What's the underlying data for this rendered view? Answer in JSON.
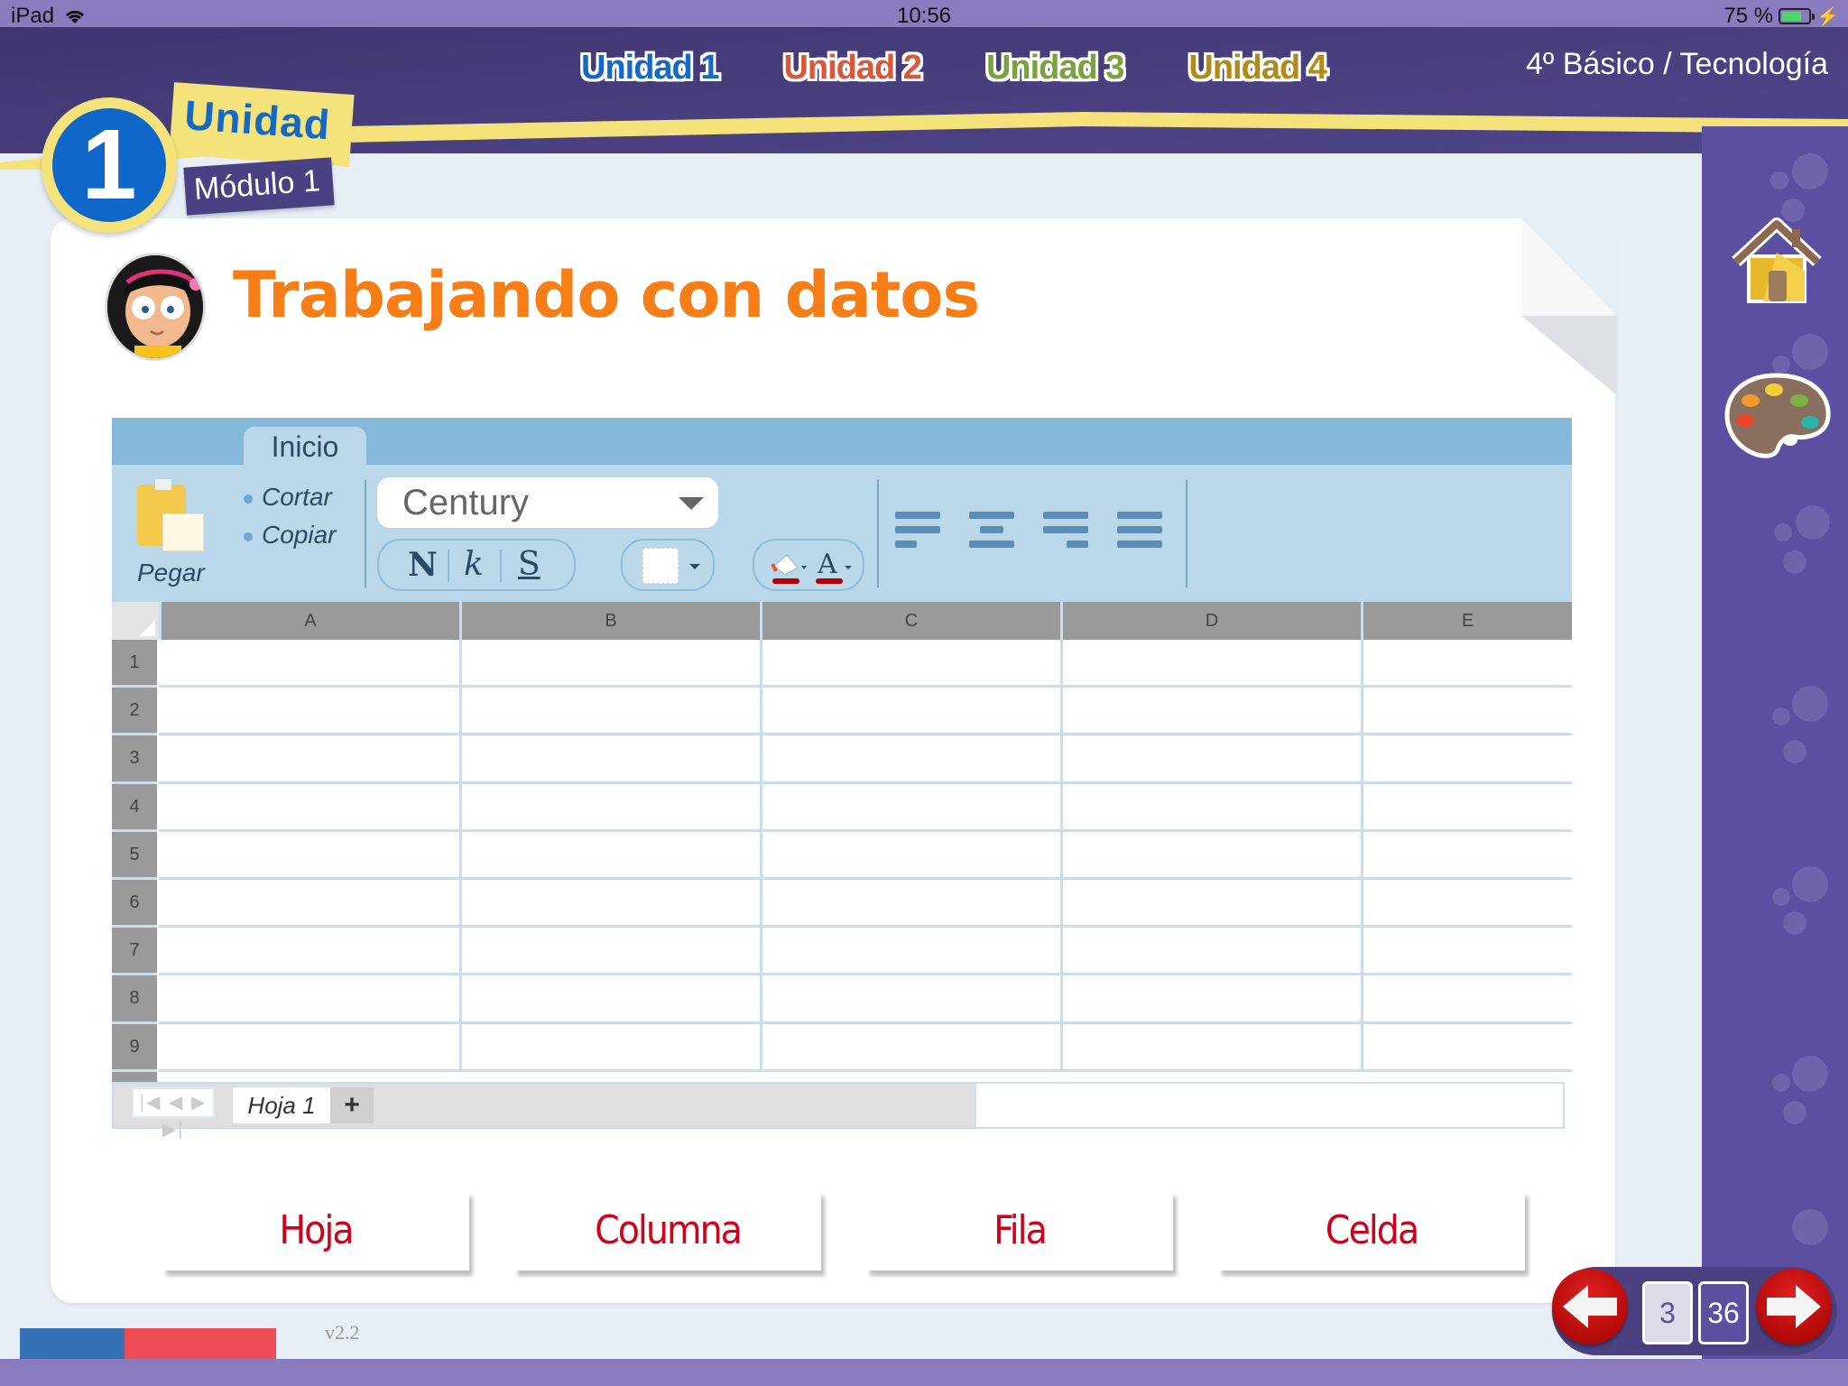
{
  "status_bar": {
    "device": "iPad",
    "time": "10:56",
    "battery": "75 %",
    "battery_level": 0.75
  },
  "header": {
    "unit_tabs": [
      {
        "label": "Unidad 1",
        "color": "#1469c7"
      },
      {
        "label": "Unidad 2",
        "color": "#d9583b"
      },
      {
        "label": "Unidad 3",
        "color": "#7aa23c"
      },
      {
        "label": "Unidad 4",
        "color": "#b08a1a"
      }
    ],
    "course": "4º Básico / Tecnología"
  },
  "unit_badge": {
    "number": "1",
    "word": "Unidad",
    "module": "Módulo 1"
  },
  "page": {
    "title": "Trabajando con datos"
  },
  "spreadsheet": {
    "ribbon_tab": "Inicio",
    "paste_label": "Pegar",
    "clipboard_items": [
      "Cortar",
      "Copiar"
    ],
    "font": "Century",
    "format_buttons": [
      "N",
      "k",
      "S"
    ],
    "columns": [
      "A",
      "B",
      "C",
      "D",
      "E"
    ],
    "rows": [
      "1",
      "2",
      "3",
      "4",
      "5",
      "6",
      "7",
      "8",
      "9"
    ],
    "sheet_nav": "|◀ ◀ ▶ ▶|",
    "sheet_tab": "Hoja 1",
    "add_sheet": "+"
  },
  "answers": [
    "Hoja",
    "Columna",
    "Fila",
    "Celda"
  ],
  "footer": {
    "version": "v2.2"
  },
  "pager": {
    "current": "3",
    "total": "36"
  },
  "sidebar": {
    "icons": [
      "home-icon",
      "palette-icon"
    ]
  }
}
